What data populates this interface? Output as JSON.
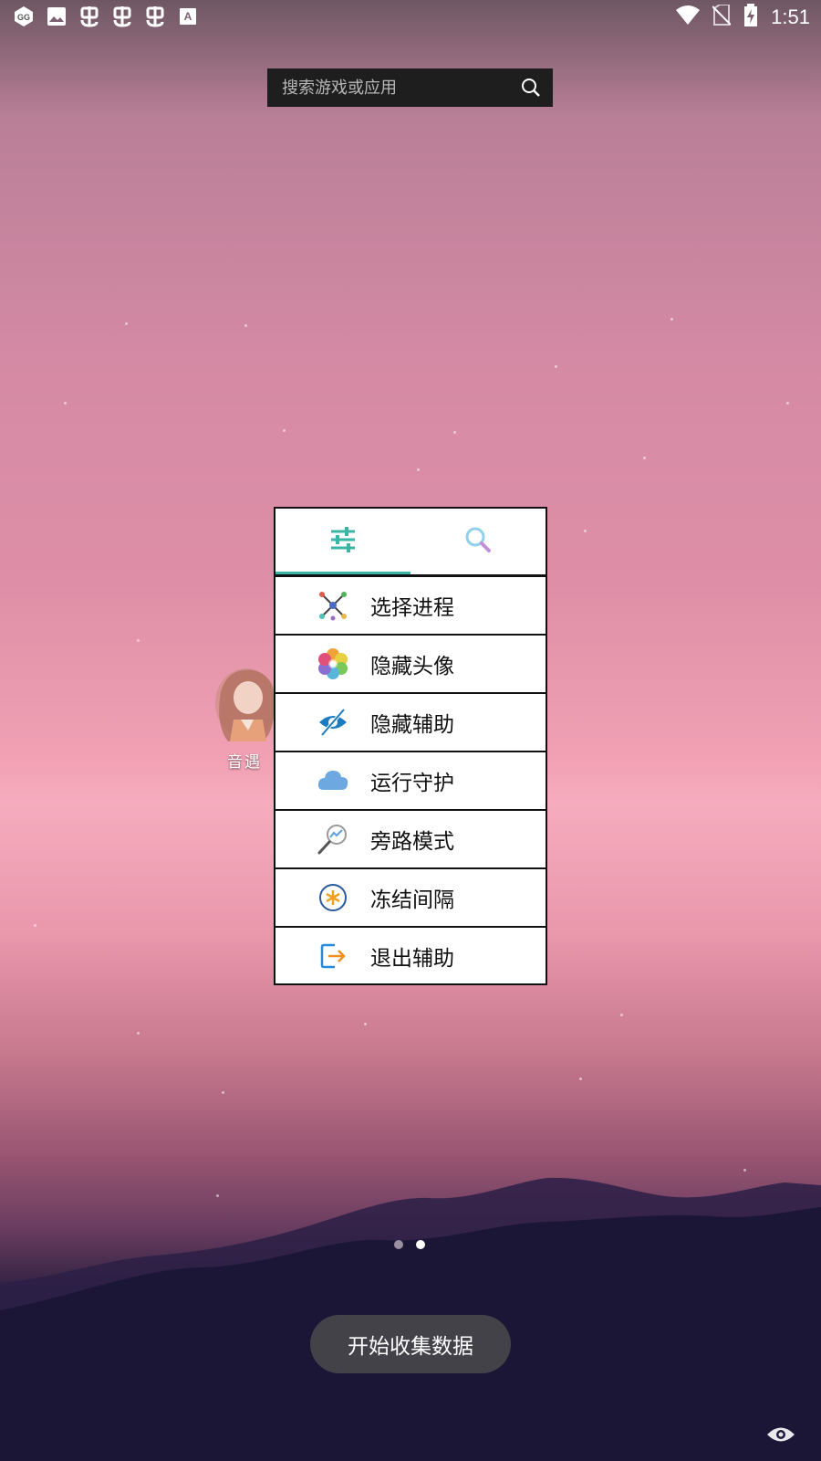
{
  "status_bar": {
    "time": "1:51",
    "left_icons": [
      "gg-app-icon",
      "image-icon",
      "bug-icon",
      "bug-icon",
      "bug-icon",
      "a-icon"
    ],
    "right_icons": [
      "wifi-icon",
      "no-sim-icon",
      "battery-charging-icon"
    ]
  },
  "search": {
    "placeholder": "搜索游戏或应用"
  },
  "desktop": {
    "app_label": "音遇",
    "page_count": 2,
    "active_page": 2
  },
  "panel": {
    "tabs": [
      {
        "icon": "sliders-icon",
        "active": true
      },
      {
        "icon": "search-icon",
        "active": false
      }
    ],
    "items": [
      {
        "label": "选择进程",
        "icon": "process-graph-icon"
      },
      {
        "label": "隐藏头像",
        "icon": "flower-icon"
      },
      {
        "label": "隐藏辅助",
        "icon": "eye-hidden-icon"
      },
      {
        "label": "运行守护",
        "icon": "cloud-icon"
      },
      {
        "label": "旁路模式",
        "icon": "magnifier-chart-icon"
      },
      {
        "label": "冻结间隔",
        "icon": "snowflake-icon"
      },
      {
        "label": "退出辅助",
        "icon": "exit-icon"
      }
    ]
  },
  "toast": {
    "text": "开始收集数据"
  },
  "colors": {
    "accent": "#3bb5a6",
    "panel_border": "#111111",
    "toast_bg": "#46464b"
  }
}
